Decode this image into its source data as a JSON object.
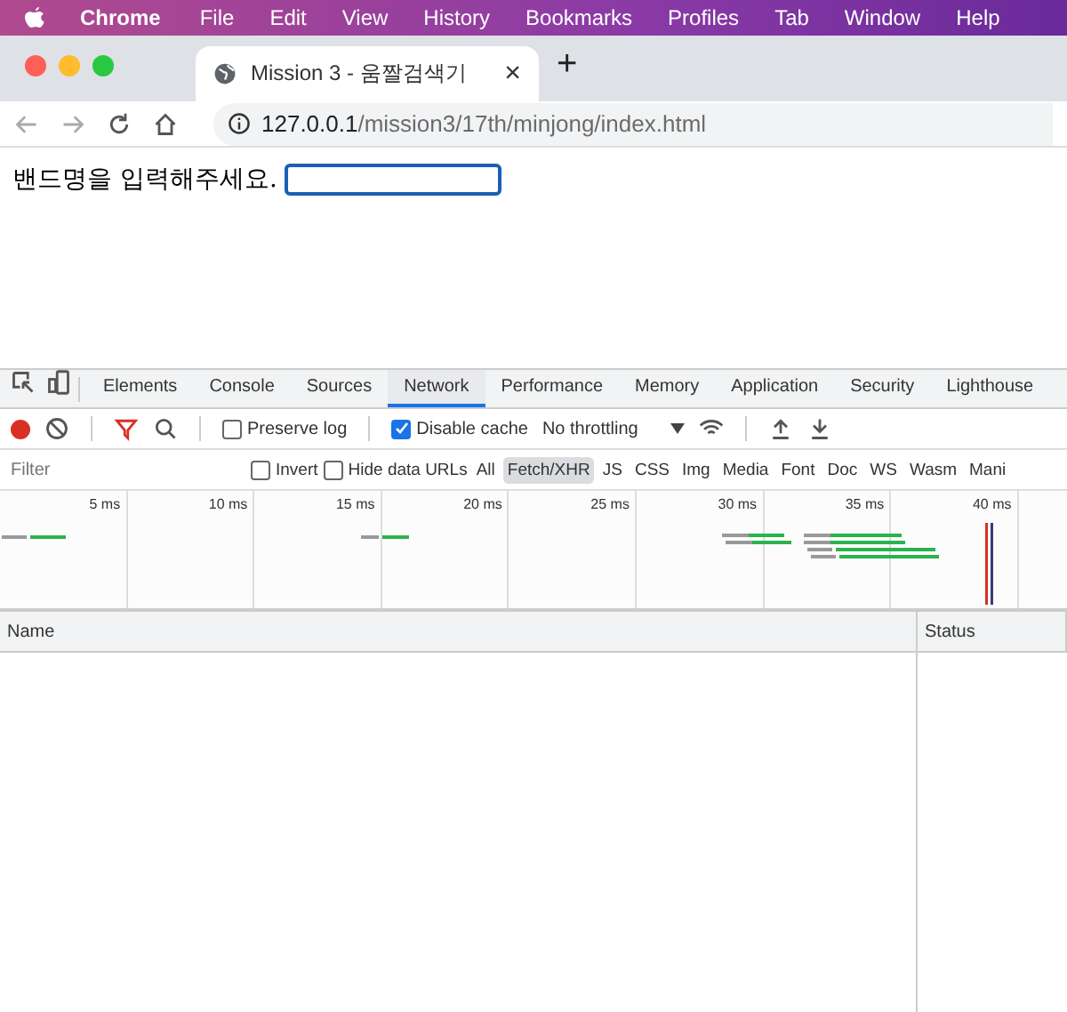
{
  "menubar": {
    "app_name": "Chrome",
    "items": [
      "File",
      "Edit",
      "View",
      "History",
      "Bookmarks",
      "Profiles",
      "Tab",
      "Window",
      "Help"
    ]
  },
  "browser_tab": {
    "title": "Mission 3 - 움짤검색기",
    "close": "×",
    "new_tab": "+"
  },
  "address_bar": {
    "host": "127.0.0.1",
    "path": "/mission3/17th/minjong/index.html"
  },
  "page": {
    "label": "밴드명을 입력해주세요.",
    "focused": true
  },
  "devtools": {
    "tabs": [
      {
        "label": "Elements",
        "selected": false
      },
      {
        "label": "Console",
        "selected": false
      },
      {
        "label": "Sources",
        "selected": false
      },
      {
        "label": "Network",
        "selected": true
      },
      {
        "label": "Performance",
        "selected": false
      },
      {
        "label": "Memory",
        "selected": false
      },
      {
        "label": "Application",
        "selected": false
      },
      {
        "label": "Security",
        "selected": false
      },
      {
        "label": "Lighthouse",
        "selected": false
      }
    ],
    "toolbar": {
      "recording": true,
      "preserve_log": {
        "label": "Preserve log",
        "checked": false
      },
      "disable_cache": {
        "label": "Disable cache",
        "checked": true
      },
      "throttling": "No throttling"
    },
    "filter": {
      "placeholder": "Filter",
      "invert": {
        "label": "Invert",
        "checked": false
      },
      "hide_data_urls": {
        "label": "Hide data URLs",
        "checked": false
      },
      "types": [
        {
          "label": "All",
          "selected": false
        },
        {
          "label": "Fetch/XHR",
          "selected": true
        },
        {
          "label": "JS",
          "selected": false
        },
        {
          "label": "CSS",
          "selected": false
        },
        {
          "label": "Img",
          "selected": false
        },
        {
          "label": "Media",
          "selected": false
        },
        {
          "label": "Font",
          "selected": false
        },
        {
          "label": "Doc",
          "selected": false
        },
        {
          "label": "WS",
          "selected": false
        },
        {
          "label": "Wasm",
          "selected": false
        },
        {
          "label": "Mani",
          "selected": false
        }
      ]
    },
    "timeline_ticks": [
      "5 ms",
      "10 ms",
      "15 ms",
      "20 ms",
      "25 ms",
      "30 ms",
      "35 ms",
      "40 ms"
    ],
    "columns": [
      "Name",
      "Status"
    ]
  }
}
